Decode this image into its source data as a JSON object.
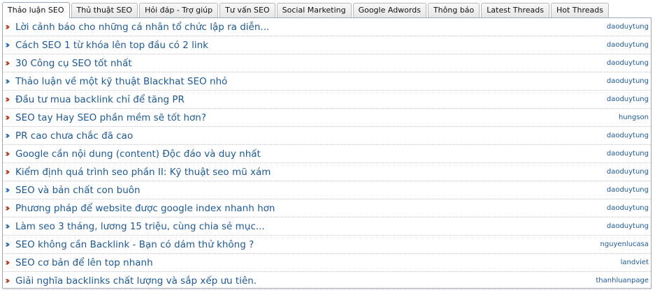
{
  "tabs": [
    {
      "label": "Thảo luận SEO",
      "active": true
    },
    {
      "label": "Thủ thuật SEO",
      "active": false
    },
    {
      "label": "Hỏi đáp - Trợ giúp",
      "active": false
    },
    {
      "label": "Tư vấn SEO",
      "active": false
    },
    {
      "label": "Social Marketing",
      "active": false
    },
    {
      "label": "Google Adwords",
      "active": false
    },
    {
      "label": "Thông báo",
      "active": false
    },
    {
      "label": "Latest Threads",
      "active": false
    },
    {
      "label": "Hot Threads",
      "active": false
    }
  ],
  "colors": {
    "arrow_red": "#b33a1a",
    "arrow_blue": "#2a6cab",
    "link": "#1d5a94"
  },
  "threads": [
    {
      "title": "Lời cảnh báo cho những cá nhân tổ chức lập ra diễn...",
      "author": "daoduytung",
      "icon": "double-arrow-red-icon"
    },
    {
      "title": "Cách SEO 1 từ khóa lên top đầu có 2 link",
      "author": "daoduytung",
      "icon": "double-arrow-blue-icon"
    },
    {
      "title": "30 Công cụ SEO tốt nhất",
      "author": "daoduytung",
      "icon": "double-arrow-red-icon"
    },
    {
      "title": "Thảo luận về một kỹ thuật Blackhat SEO nhỏ",
      "author": "daoduytung",
      "icon": "double-arrow-blue-icon"
    },
    {
      "title": "Đầu tư mua backlink chỉ để tăng PR",
      "author": "daoduytung",
      "icon": "double-arrow-red-icon"
    },
    {
      "title": "SEO tay Hay SEO phần mềm sẽ tốt hơn?",
      "author": "hungson",
      "icon": "double-arrow-red-icon"
    },
    {
      "title": "PR cao chưa chắc đã cao",
      "author": "daoduytung",
      "icon": "double-arrow-blue-icon"
    },
    {
      "title": "Google cần nội dung (content) Độc đáo và duy nhất",
      "author": "daoduytung",
      "icon": "double-arrow-red-icon"
    },
    {
      "title": "Kiểm định quá trình seo phần II: Kỹ thuật seo mũ xám",
      "author": "daoduytung",
      "icon": "double-arrow-red-icon"
    },
    {
      "title": "SEO và bản chất con buôn",
      "author": "daoduytung",
      "icon": "double-arrow-blue-icon"
    },
    {
      "title": "Phương pháp để website được google index nhanh hơn",
      "author": "daoduytung",
      "icon": "double-arrow-red-icon"
    },
    {
      "title": "Làm seo 3 tháng, lương 15 triệu, cùng chia sẻ mục...",
      "author": "daoduytung",
      "icon": "double-arrow-blue-icon"
    },
    {
      "title": "SEO không cần Backlink - Bạn có dám thử không ?",
      "author": "nguyenlucasa",
      "icon": "double-arrow-blue-icon"
    },
    {
      "title": "SEO cơ bản để lên top nhanh",
      "author": "landviet",
      "icon": "double-arrow-red-icon"
    },
    {
      "title": "Giải nghĩa backlinks chất lượng và sắp xếp ưu tiên.",
      "author": "thanhluanpage",
      "icon": "double-arrow-red-icon"
    }
  ]
}
